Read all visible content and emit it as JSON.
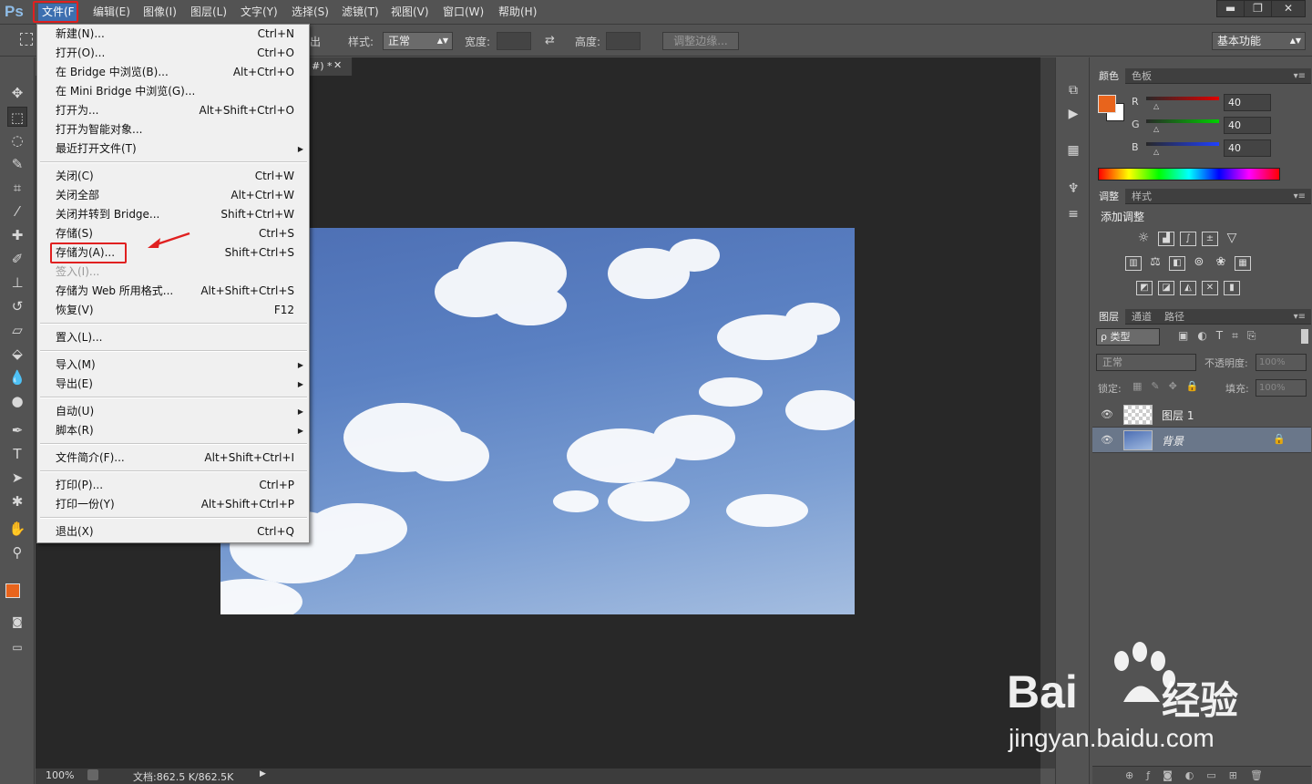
{
  "app": {
    "logo": "Ps"
  },
  "menubar": {
    "items": [
      "文件(F",
      "编辑(E)",
      "图像(I)",
      "图层(L)",
      "文字(Y)",
      "选择(S)",
      "滤镜(T)",
      "视图(V)",
      "窗口(W)",
      "帮助(H)"
    ]
  },
  "window_controls": {
    "minimize": "▬",
    "restore": "❐",
    "close": "✕"
  },
  "options": {
    "partial_label": "出",
    "style_label": "样式:",
    "style_value": "正常",
    "width_label": "宽度:",
    "height_label": "高度:",
    "refine_edge": "调整边缘...",
    "workspace_value": "基本功能"
  },
  "document": {
    "tab_fragment": "#) *",
    "tab_close": "✕"
  },
  "file_menu": {
    "items": [
      {
        "label": "新建(N)...",
        "shortcut": "Ctrl+N"
      },
      {
        "label": "打开(O)...",
        "shortcut": "Ctrl+O"
      },
      {
        "label": "在 Bridge 中浏览(B)...",
        "shortcut": "Alt+Ctrl+O"
      },
      {
        "label": "在 Mini Bridge 中浏览(G)...",
        "shortcut": ""
      },
      {
        "label": "打开为...",
        "shortcut": "Alt+Shift+Ctrl+O"
      },
      {
        "label": "打开为智能对象...",
        "shortcut": ""
      },
      {
        "label": "最近打开文件(T)",
        "shortcut": "",
        "submenu": true
      },
      {
        "label": "关闭(C)",
        "shortcut": "Ctrl+W"
      },
      {
        "label": "关闭全部",
        "shortcut": "Alt+Ctrl+W"
      },
      {
        "label": "关闭并转到 Bridge...",
        "shortcut": "Shift+Ctrl+W"
      },
      {
        "label": "存储(S)",
        "shortcut": "Ctrl+S"
      },
      {
        "label": "存储为(A)...",
        "shortcut": "Shift+Ctrl+S"
      },
      {
        "label": "签入(I)...",
        "shortcut": "",
        "disabled": true
      },
      {
        "label": "存储为 Web 所用格式...",
        "shortcut": "Alt+Shift+Ctrl+S"
      },
      {
        "label": "恢复(V)",
        "shortcut": "F12"
      },
      {
        "label": "置入(L)...",
        "shortcut": ""
      },
      {
        "label": "导入(M)",
        "shortcut": "",
        "submenu": true
      },
      {
        "label": "导出(E)",
        "shortcut": "",
        "submenu": true
      },
      {
        "label": "自动(U)",
        "shortcut": "",
        "submenu": true
      },
      {
        "label": "脚本(R)",
        "shortcut": "",
        "submenu": true
      },
      {
        "label": "文件简介(F)...",
        "shortcut": "Alt+Shift+Ctrl+I"
      },
      {
        "label": "打印(P)...",
        "shortcut": "Ctrl+P"
      },
      {
        "label": "打印一份(Y)",
        "shortcut": "Alt+Shift+Ctrl+P"
      },
      {
        "label": "退出(X)",
        "shortcut": "Ctrl+Q"
      }
    ]
  },
  "color_panel": {
    "tabs": [
      "颜色",
      "色板"
    ],
    "channels": [
      {
        "name": "R",
        "value": "40"
      },
      {
        "name": "G",
        "value": "40"
      },
      {
        "name": "B",
        "value": "40"
      }
    ],
    "foreground": "#e8641c",
    "background": "#ffffff"
  },
  "adjustments_panel": {
    "tabs": [
      "调整",
      "样式"
    ],
    "title": "添加调整",
    "icons": [
      "brightness-icon",
      "levels-icon",
      "curves-icon",
      "exposure-icon",
      "vibrance-icon",
      "hue-sat-icon",
      "color-balance-icon",
      "bw-icon",
      "photo-filter-icon",
      "channel-mixer-icon",
      "color-lookup-icon",
      "invert-icon",
      "posterize-icon",
      "threshold-icon",
      "selective-color-icon",
      "gradient-map-icon"
    ]
  },
  "layers_panel": {
    "tabs": [
      "图层",
      "通道",
      "路径"
    ],
    "kind_label": "ρ 类型",
    "blend_mode": "正常",
    "opacity_label": "不透明度:",
    "opacity_value": "100%",
    "lock_label": "锁定:",
    "fill_label": "填充:",
    "fill_value": "100%",
    "layers": [
      {
        "name": "图层 1",
        "selected": false
      },
      {
        "name": "背景",
        "selected": true
      }
    ]
  },
  "status": {
    "zoom": "100%",
    "doc_size": "文档:862.5 K/862.5K"
  },
  "watermark": {
    "brand": "Bai",
    "brand_cn": "经验",
    "url": "jingyan.baidu.com"
  }
}
